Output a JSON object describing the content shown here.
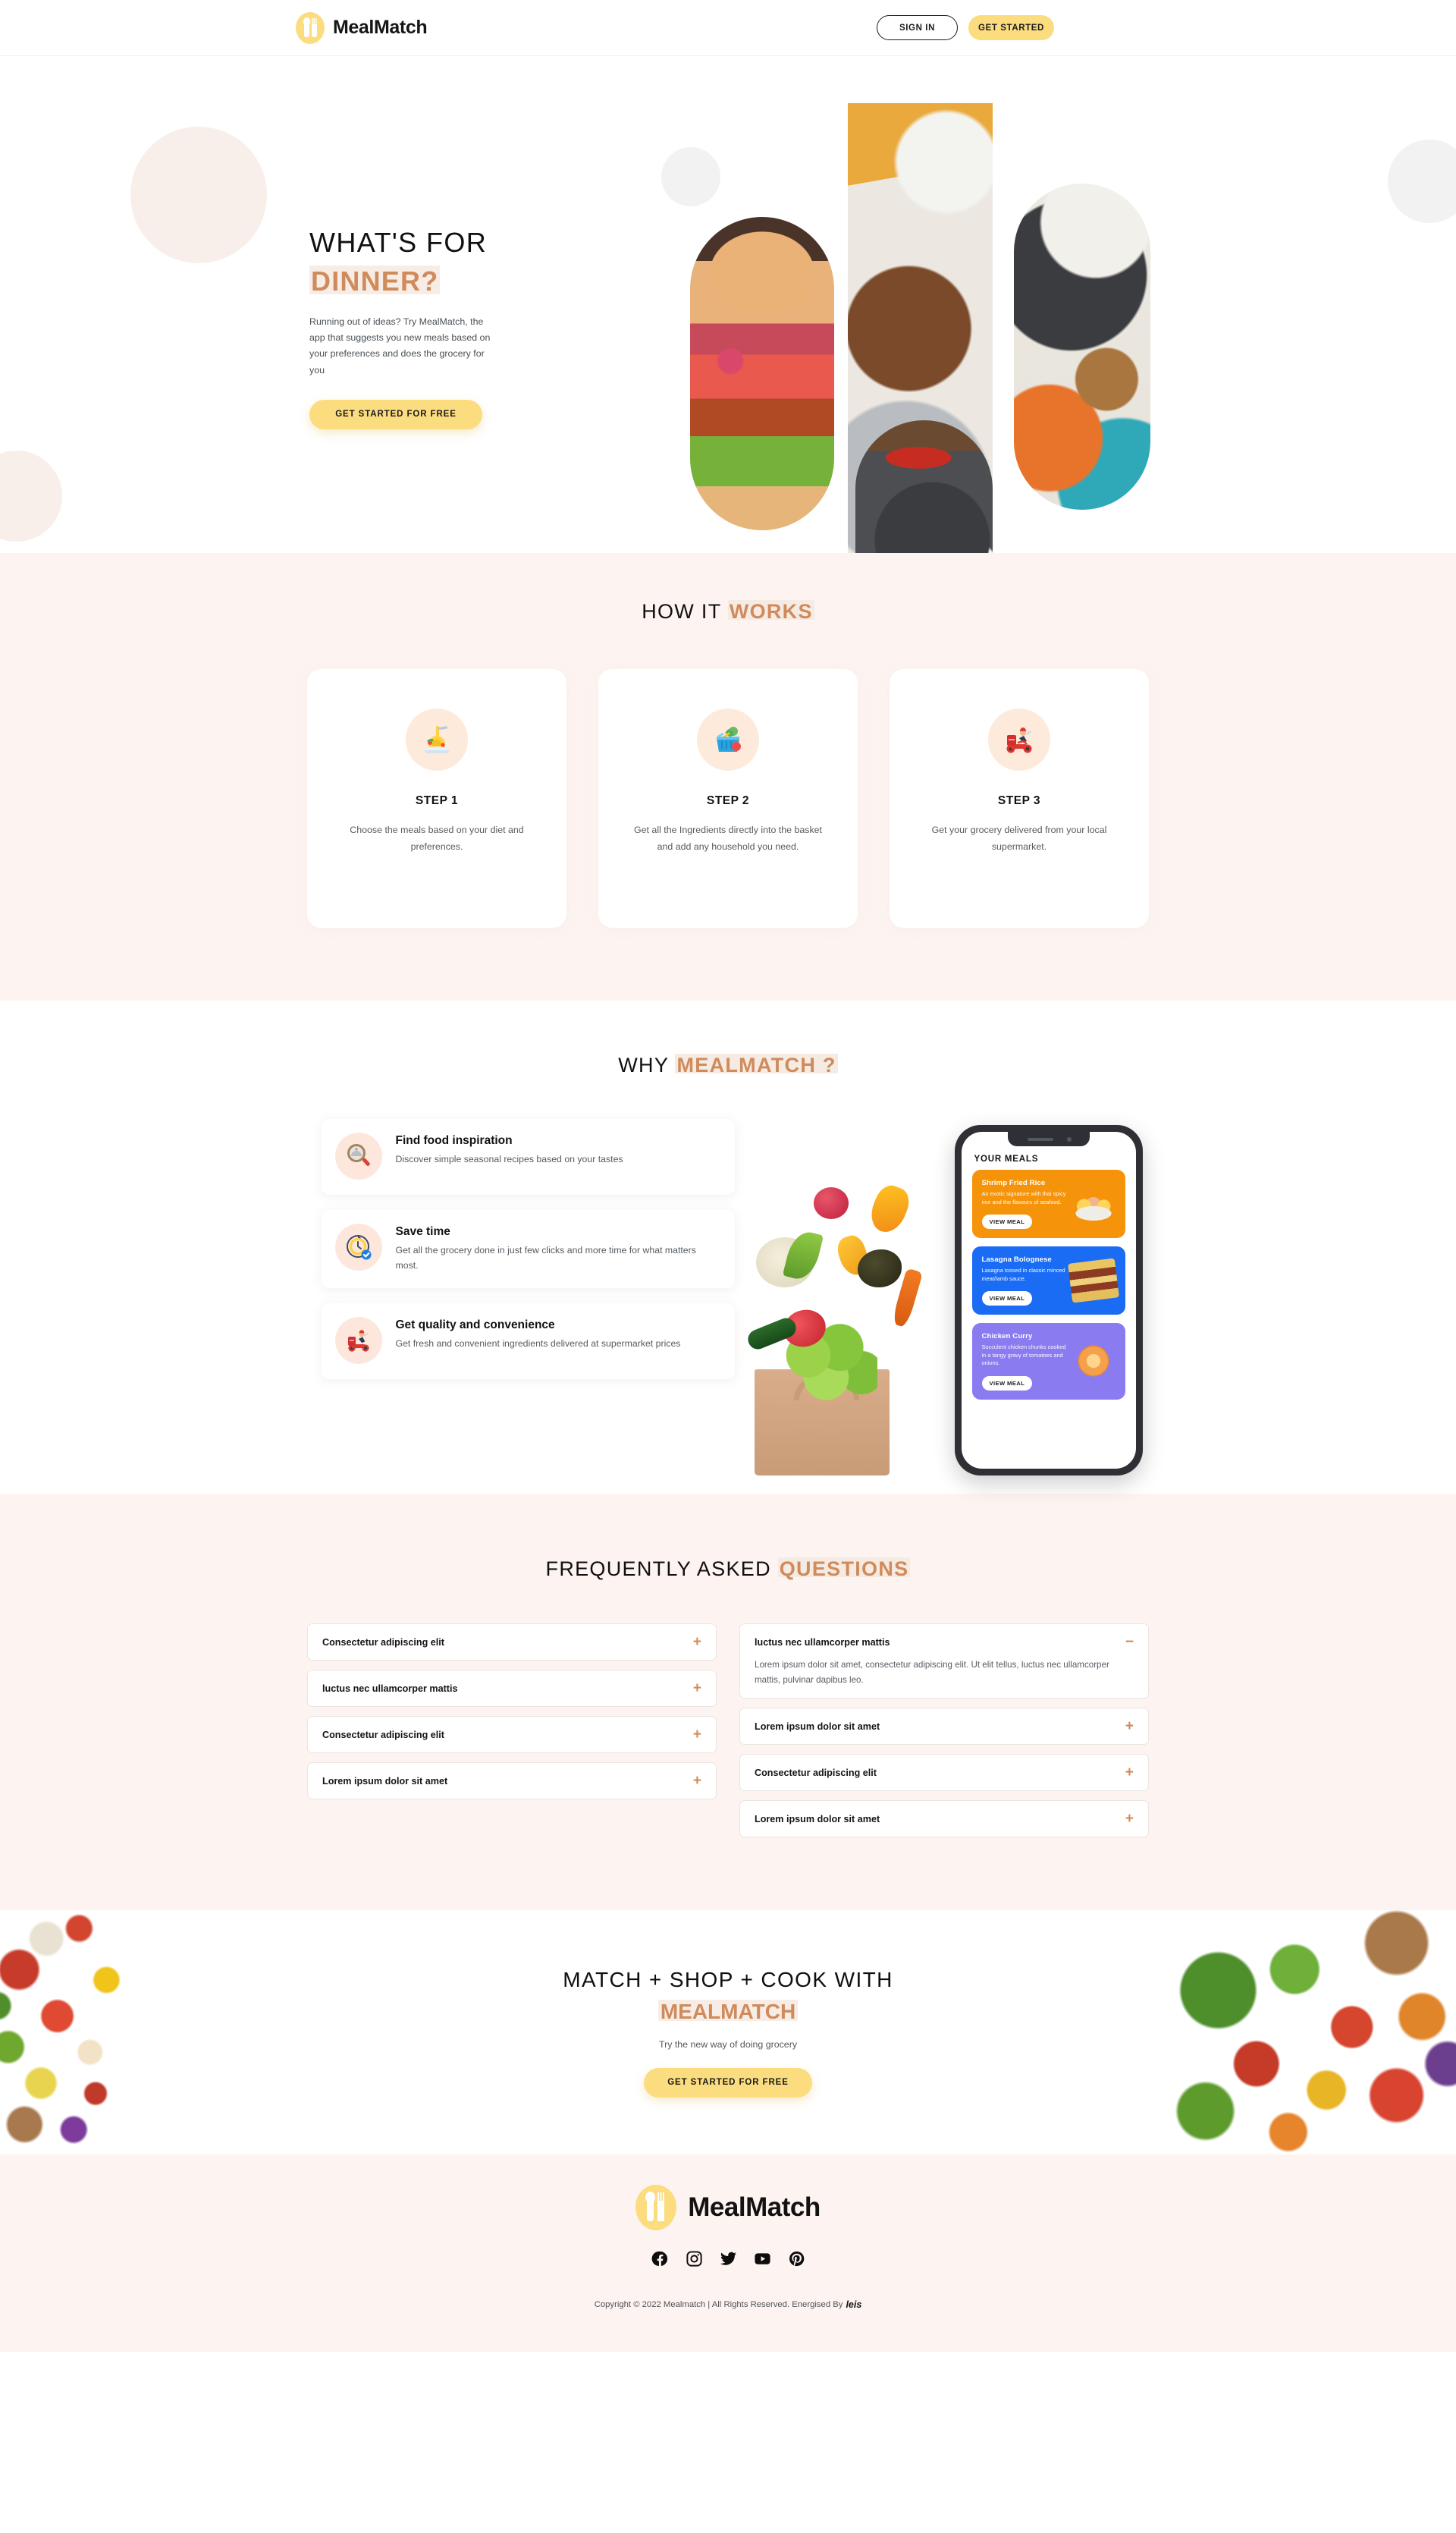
{
  "header": {
    "brand": "MealMatch",
    "sign_in_label": "SIGN IN",
    "get_started_label": "GET STARTED"
  },
  "hero": {
    "title_line1": "WHAT'S FOR",
    "title_line2": "DINNER?",
    "subtitle": "Running out of ideas? Try MealMatch, the app that suggests you new meals based on your preferences and does the grocery for you",
    "cta_label": "GET STARTED FOR FREE"
  },
  "how_it_works": {
    "title_plain": "HOW IT ",
    "title_accent": "WORKS",
    "steps": [
      {
        "icon": "pasta-plate-icon",
        "title": "STEP 1",
        "body": "Choose the meals based on your diet and preferences."
      },
      {
        "icon": "grocery-basket-icon",
        "title": "STEP 2",
        "body": "Get all the Ingredients directly into the basket and add any household you need."
      },
      {
        "icon": "delivery-scooter-icon",
        "title": "STEP 3",
        "body": "Get your grocery delivered from your local supermarket."
      }
    ]
  },
  "why": {
    "title_plain": "WHY ",
    "title_accent": "MEALMATCH ?",
    "features": [
      {
        "icon": "magnifier-dish-icon",
        "title": "Find food inspiration",
        "body": "Discover simple seasonal recipes based on your tastes"
      },
      {
        "icon": "clock-check-icon",
        "title": "Save time",
        "body": "Get all the grocery done in just few clicks and more time for what matters most."
      },
      {
        "icon": "delivery-scooter-icon",
        "title": "Get quality and convenience",
        "body": "Get fresh and convenient ingredients delivered at supermarket prices"
      }
    ],
    "phone": {
      "screen_title": "YOUR MEALS",
      "meals": [
        {
          "name": "Shrimp Fried Rice",
          "desc": "An exotic signature with thai spicy rice and the flavours of seafood.",
          "button": "VIEW MEAL",
          "color": "#F5940B",
          "thumb": "shrimp-fried-rice-icon"
        },
        {
          "name": "Lasagna Bolognese",
          "desc": "Lasagna tossed in classic minced meat/lamb sauce.",
          "button": "VIEW MEAL",
          "color": "#1A6CF5",
          "thumb": "lasagna-icon"
        },
        {
          "name": "Chicken Curry",
          "desc": "Succulent chicken chunks cooked in a tangy gravy of tomatoes and onions.",
          "button": "VIEW MEAL",
          "color": "#8A7BF0",
          "thumb": "curry-bowl-icon"
        }
      ]
    }
  },
  "faq": {
    "title_plain": "FREQUENTLY ASKED ",
    "title_accent": "QUESTIONS",
    "left_items": [
      {
        "question": "Consectetur adipiscing elit",
        "sign": "+",
        "expanded": false,
        "answer": ""
      },
      {
        "question": "luctus nec ullamcorper mattis",
        "sign": "+",
        "expanded": false,
        "answer": ""
      },
      {
        "question": "Consectetur adipiscing elit",
        "sign": "+",
        "expanded": false,
        "answer": ""
      },
      {
        "question": "Lorem ipsum dolor sit amet",
        "sign": "+",
        "expanded": false,
        "answer": ""
      }
    ],
    "right_items": [
      {
        "question": "luctus nec ullamcorper mattis",
        "sign": "−",
        "expanded": true,
        "answer": "Lorem ipsum dolor sit amet, consectetur adipiscing elit. Ut elit tellus, luctus nec ullamcorper mattis, pulvinar dapibus leo."
      },
      {
        "question": "Lorem ipsum dolor sit amet",
        "sign": "+",
        "expanded": false,
        "answer": ""
      },
      {
        "question": "Consectetur adipiscing elit",
        "sign": "+",
        "expanded": false,
        "answer": ""
      },
      {
        "question": "Lorem ipsum dolor sit amet",
        "sign": "+",
        "expanded": false,
        "answer": ""
      }
    ]
  },
  "cta": {
    "title_plain": "MATCH + SHOP + COOK WITH",
    "title_accent": "MEALMATCH",
    "subtitle": "Try the new way of doing grocery",
    "button": "GET STARTED FOR FREE"
  },
  "footer": {
    "brand": "MealMatch",
    "socials": [
      "facebook-icon",
      "instagram-icon",
      "twitter-icon",
      "youtube-icon",
      "pinterest-icon"
    ],
    "copyright": "Copyright © 2022 Mealmatch | All Rights Reserved. Energised By",
    "partner": "leis"
  },
  "colors": {
    "accent": "#D08B5C",
    "yellow": "#FBDC7F",
    "section_bg": "#FDF4F1",
    "highlight": "#F7EDE6"
  }
}
